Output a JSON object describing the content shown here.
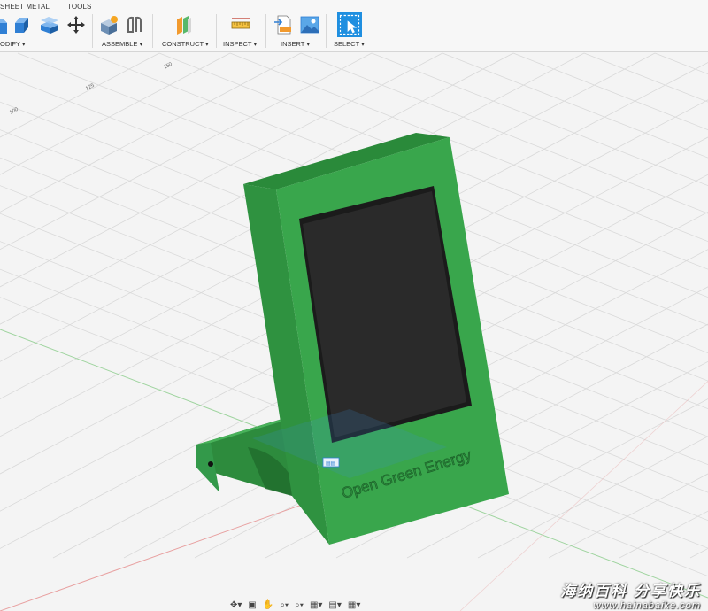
{
  "toolbar": {
    "tabs": [
      "SHEET METAL",
      "TOOLS"
    ],
    "groups": [
      {
        "label": "ODIFY ▾"
      },
      {
        "label": "ASSEMBLE ▾"
      },
      {
        "label": "CONSTRUCT ▾"
      },
      {
        "label": "INSPECT ▾"
      },
      {
        "label": "INSERT ▾"
      },
      {
        "label": "SELECT ▾"
      }
    ],
    "icons": [
      "modify-icon",
      "push-pull-icon",
      "shell-icon",
      "move-icon",
      "new-component-icon",
      "joint-icon",
      "offset-plane-icon",
      "measure-icon",
      "insert-svg-icon",
      "insert-image-icon",
      "select-icon"
    ]
  },
  "viewport": {
    "model_text": "Open Green Energy",
    "grid_labels": [
      "100",
      "125",
      "150"
    ],
    "colors": {
      "model": "#36a048",
      "model_dark": "#2c8a3c",
      "screen": "#252525",
      "grid": "#d9d9d9"
    }
  },
  "navbar": {
    "items": [
      "✥▾",
      "▣",
      "✋",
      "⌕▾",
      "⌕▾",
      "▦▾",
      "▤▾",
      "▦▾"
    ]
  },
  "watermark": {
    "chinese": "海纳百科 分享快乐",
    "url": "www.hainabaike.com"
  }
}
